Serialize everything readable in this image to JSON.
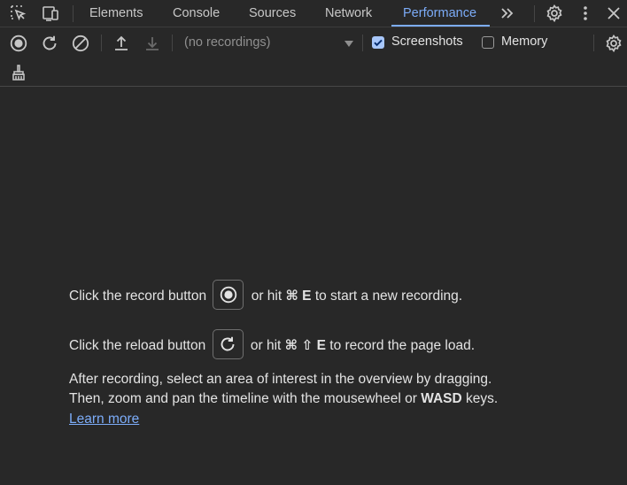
{
  "tabs": {
    "items": [
      {
        "label": "Elements"
      },
      {
        "label": "Console"
      },
      {
        "label": "Sources"
      },
      {
        "label": "Network"
      },
      {
        "label": "Performance"
      }
    ],
    "overflow_glyph": "»"
  },
  "toolbar": {
    "recordings_select": {
      "value": "(no recordings)"
    },
    "screenshots": {
      "label": "Screenshots",
      "checked": true
    },
    "memory": {
      "label": "Memory",
      "checked": false
    }
  },
  "landing": {
    "record_prefix": "Click the record button",
    "record_mid": "or hit",
    "record_keys": "⌘ E",
    "record_suffix": "to start a new recording.",
    "reload_prefix": "Click the reload button",
    "reload_mid": "or hit",
    "reload_keys": "⌘ ⇧ E",
    "reload_suffix": "to record the page load.",
    "hint_line1": "After recording, select an area of interest in the overview by dragging.",
    "hint_line2_prefix": "Then, zoom and pan the timeline with the mousewheel or",
    "hint_line2_keys": "WASD",
    "hint_line2_suffix": "keys.",
    "learn_more": "Learn more"
  },
  "colors": {
    "background": "#282828",
    "accent": "#7cacf8",
    "text": "#e3e3e3",
    "muted_text": "#8f8f8f"
  }
}
